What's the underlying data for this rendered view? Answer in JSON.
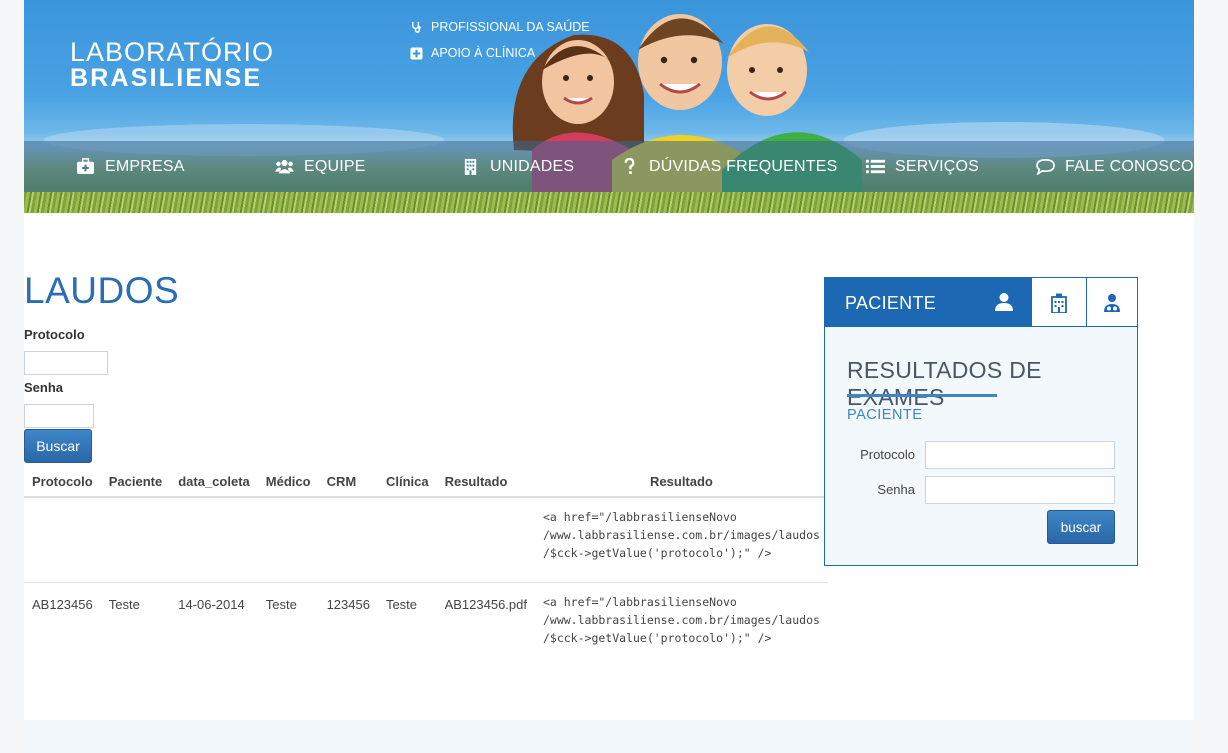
{
  "header": {
    "logo_line1": "LABORATÓRIO",
    "logo_line2": "BRASILIENSE",
    "top_links": [
      {
        "label": "PROFISSIONAL DA SAÚDE",
        "icon": "stethoscope-icon"
      },
      {
        "label": "APOIO À CLÍNICA",
        "icon": "plus-square-icon"
      }
    ],
    "nav": [
      {
        "label": "EMPRESA",
        "icon": "medkit-icon"
      },
      {
        "label": "EQUIPE",
        "icon": "users-icon"
      },
      {
        "label": "UNIDADES",
        "icon": "building-icon"
      },
      {
        "label": "DÚVIDAS FREQUENTES",
        "icon": "question-icon"
      },
      {
        "label": "SERVIÇOS",
        "icon": "list-icon"
      },
      {
        "label": "FALE CONOSCO",
        "icon": "comment-icon"
      }
    ]
  },
  "main": {
    "title": "LAUDOS",
    "protocolo_label": "Protocolo",
    "senha_label": "Senha",
    "protocolo_value": "",
    "senha_value": "",
    "search_button": "Buscar",
    "table": {
      "headers": [
        "Protocolo",
        "Paciente",
        "data_coleta",
        "Médico",
        "CRM",
        "Clínica",
        "Resultado",
        "Resultado"
      ],
      "rows": [
        [
          "",
          "",
          "",
          "",
          "",
          "",
          "",
          "<a href=\"/labbrasilienseNovo\n/www.labbrasiliense.com.br/images/laudos\n/$cck->getValue('protocolo');\" />"
        ],
        [
          "AB123456",
          "Teste",
          "14-06-2014",
          "Teste",
          "123456",
          "Teste",
          "AB123456.pdf",
          "<a href=\"/labbrasilienseNovo\n/www.labbrasiliense.com.br/images/laudos\n/$cck->getValue('protocolo');\" />"
        ]
      ]
    }
  },
  "panel": {
    "active_tab": "PACIENTE",
    "tab_icons": [
      "user-icon",
      "hospital-icon",
      "doctor-icon"
    ],
    "title": "RESULTADOS DE EXAMES",
    "subtitle": "PACIENTE",
    "protocolo_label": "Protocolo",
    "senha_label": "Senha",
    "protocolo_value": "",
    "senha_value": "",
    "button": "buscar"
  },
  "colors": {
    "brand_blue": "#1d68b3",
    "title_blue": "#2a6db5",
    "header_sky": "#3b95dc"
  }
}
